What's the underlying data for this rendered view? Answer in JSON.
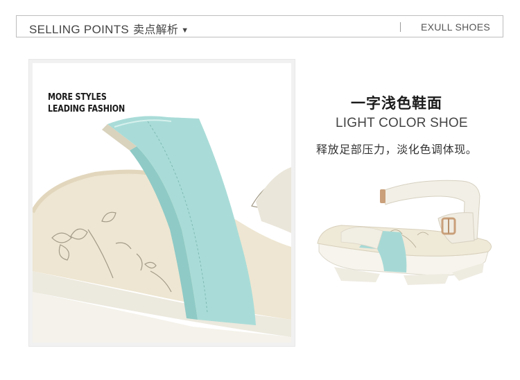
{
  "header": {
    "title_en": "SELLING POINTS",
    "title_cn": "卖点解析",
    "dropdown_glyph": "▼",
    "brand": "EXULL SHOES"
  },
  "closeup": {
    "slogan_line1": "MORE STYLES",
    "slogan_line2": "LEADING FASHION"
  },
  "feature": {
    "title_cn": "一字浅色鞋面",
    "title_en": "LIGHT COLOR SHOE",
    "description": "释放足部压力，淡化色调体现。"
  },
  "colors": {
    "strap": "#a8dcd8",
    "sole": "#f3f0e6",
    "insole": "#ebe3cf",
    "buckle": "#c8a079"
  }
}
